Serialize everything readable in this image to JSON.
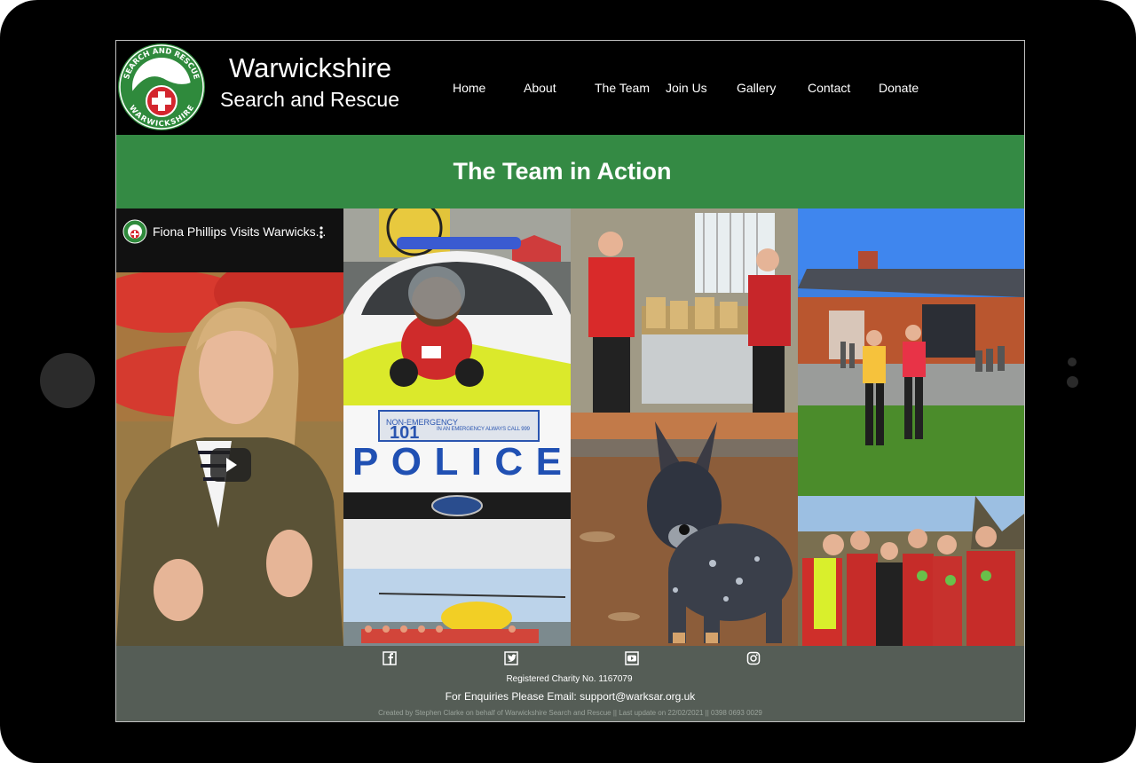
{
  "site": {
    "title_line1": "Warwickshire",
    "title_line2": "Search and Rescue",
    "logo": {
      "top_text": "SEARCH AND RESCUE",
      "bottom_text": "WARWICKSHIRE"
    }
  },
  "nav": {
    "items": [
      {
        "label": "Home"
      },
      {
        "label": "About"
      },
      {
        "label": "The Team"
      },
      {
        "label": "Join Us"
      },
      {
        "label": "Gallery"
      },
      {
        "label": "Contact"
      },
      {
        "label": "Donate"
      }
    ]
  },
  "banner": {
    "title": "The Team in Action"
  },
  "video": {
    "title": "Fiona Phillips Visits Warwicks...",
    "menu_icon": "more-vert-icon",
    "play_icon": "play-icon"
  },
  "photos": {
    "police_car_text": "POLICE",
    "police_number": "101",
    "police_small_text": "IN AN EMERGENCY ALWAYS CALL 999",
    "police_non_emergency": "NON-EMERGENCY"
  },
  "footer": {
    "social": [
      {
        "icon": "facebook-icon"
      },
      {
        "icon": "twitter-icon"
      },
      {
        "icon": "youtube-icon"
      },
      {
        "icon": "instagram-icon"
      }
    ],
    "registered": "Registered Charity No. 1167079",
    "enquiries": "For Enquiries Please Email: support@warksar.org.uk",
    "credit": "Created by Stephen Clarke on behalf of Warwickshire Search and Rescue || Last update on 22/02/2021 || 0398 0693 0029"
  },
  "colors": {
    "header_bg": "#000000",
    "banner_green": "#348a44",
    "footer_bg": "#555d56"
  }
}
